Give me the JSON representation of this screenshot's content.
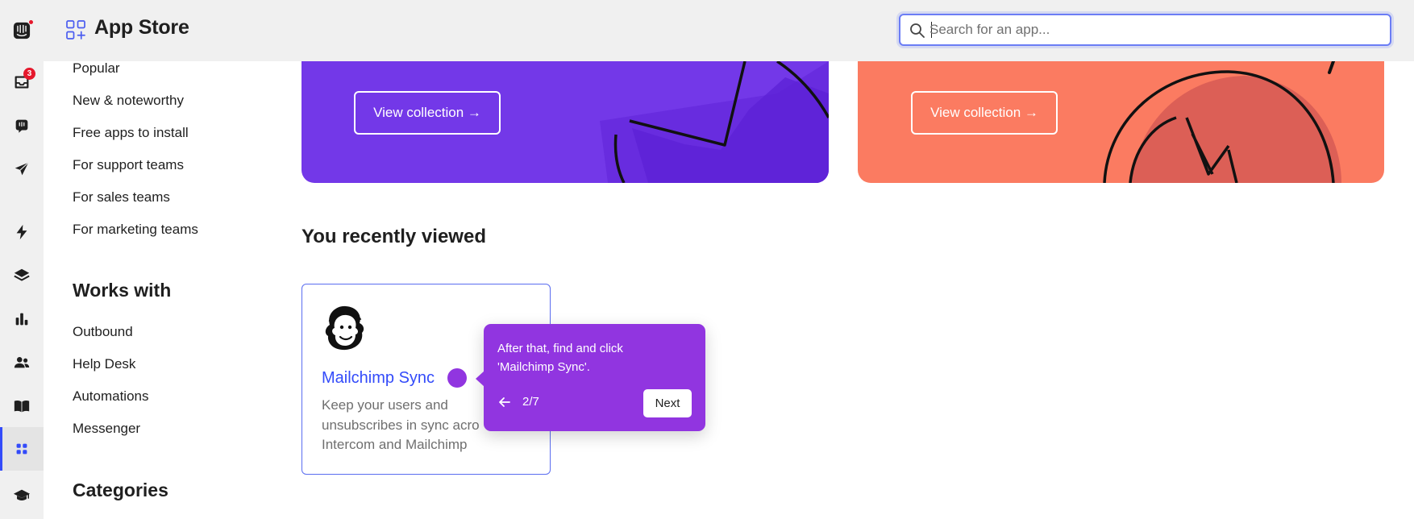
{
  "header": {
    "title": "App Store",
    "search": {
      "placeholder": "Search for an app...",
      "value": ""
    }
  },
  "rail": {
    "items": [
      {
        "icon": "intercom-logo-icon"
      },
      {
        "icon": "inbox-icon",
        "badge": "3"
      },
      {
        "icon": "messenger-icon"
      },
      {
        "icon": "outbound-icon"
      },
      {
        "icon": "automation-icon"
      },
      {
        "icon": "layers-icon"
      },
      {
        "icon": "reports-icon"
      },
      {
        "icon": "contacts-icon"
      },
      {
        "icon": "articles-icon"
      },
      {
        "icon": "app-store-icon",
        "active": true
      },
      {
        "icon": "academy-icon"
      }
    ]
  },
  "nav": {
    "collections": [
      "Popular",
      "New & noteworthy",
      "Free apps to install",
      "For support teams",
      "For sales teams",
      "For marketing teams"
    ],
    "works_with_heading": "Works with",
    "works_with": [
      "Outbound",
      "Help Desk",
      "Automations",
      "Messenger"
    ],
    "categories_heading": "Categories"
  },
  "banners": [
    {
      "button_label": "View collection →",
      "color": "#7338e8"
    },
    {
      "button_label": "View collection →",
      "color": "#fb7b61"
    }
  ],
  "recent": {
    "heading": "You recently viewed",
    "apps": [
      {
        "name": "Mailchimp Sync",
        "desc_lines": [
          "Keep your users and",
          "unsubscribes in sync acro",
          "Intercom and Mailchimp"
        ]
      }
    ]
  },
  "tour": {
    "text_line1": "After that, find and click",
    "text_line2": "'Mailchimp Sync'.",
    "step": "2/7",
    "next_label": "Next"
  },
  "colors": {
    "accent": "#334bfa",
    "tour": "#9135e0",
    "badge": "#e5182c"
  }
}
